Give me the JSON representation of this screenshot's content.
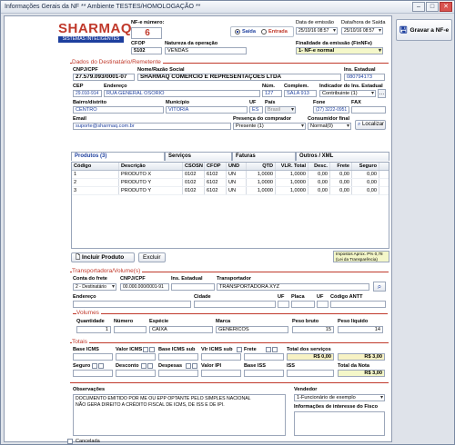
{
  "window": {
    "title": "Informações Gerais da NF  ** Ambiente TESTES/HOMOLOGAÇÃO **"
  },
  "brand": {
    "name": "SHARMAQ",
    "sub": "SISTEMAS INTELIGENTES",
    "color": "#c0392b"
  },
  "header": {
    "nf_number_label": "NF-e número:",
    "nf_number": "6",
    "cfop_label": "CFOP",
    "cfop": "5102",
    "natureza_label": "Natureza da operação",
    "natureza": "VENDAS",
    "saida_label": "Saída",
    "entrada_label": "Entrada",
    "data_emissao_label": "Data de emissão",
    "data_emissao": "25/10/16 08:57",
    "data_saida_label": "Data/hora de Saída",
    "data_saida": "25/10/16 08:57",
    "finalidade_label": "Finalidade da emissão (FinNFe)",
    "finalidade": "1- NF-e normal"
  },
  "dest": {
    "section": "Dados do Destinatário/Remetente",
    "cnpj_label": "CNPJ/CPF",
    "cnpj": "27.579.093/0001-07",
    "nome_label": "Nome/Razão Social",
    "nome": "SHARMAQ COMÉRCIO E REPRESENTAÇÕES LTDA",
    "ie_label": "Ins. Estadual",
    "ie": "080794173",
    "cep_label": "CEP",
    "cep": "29.010-914",
    "endereco_label": "Endereço",
    "endereco": "RUA GENERAL OSÓRIO",
    "num_label": "Núm.",
    "num": "127",
    "compl_label": "Complem.",
    "compl": "SALA 913",
    "ind_ie_label": "Indicador do Ins. Estadual",
    "ind_ie": "Contribuinte (1)",
    "bairro_label": "Bairro/distrito",
    "bairro": "CENTRO",
    "municipio_label": "Município",
    "municipio": "VITÓRIA",
    "uf_label": "UF",
    "uf": "ES",
    "pais_label": "País",
    "pais": "Brasil",
    "fone_label": "Fone",
    "fone": "(27) 3222-0951",
    "fax_label": "FAX",
    "email_label": "Email",
    "email": "suporte@sharmaq.com.br",
    "presenca_label": "Presença do comprador",
    "presenca": "Presente (1)",
    "consumidor_label": "Consumidor final",
    "consumidor": "Normal(0)",
    "localizar": "Localizar"
  },
  "tabs": [
    "Produtos (3)",
    "Serviços",
    "Faturas",
    "Outros / XML"
  ],
  "products": {
    "columns": [
      "Código",
      "Descrição",
      "CSOSN",
      "CFOP",
      "UND",
      "QTD",
      "VLR. Total",
      "Desc.",
      "Frete",
      "Seguro"
    ],
    "rows": [
      [
        "1",
        "PRODUTO X",
        "0102",
        "6102",
        "UN",
        "1,0000",
        "1,0000",
        "0,00",
        "0,00",
        "0,00"
      ],
      [
        "2",
        "PRODUTO Y",
        "0102",
        "6102",
        "UN",
        "1,0000",
        "1,0000",
        "0,00",
        "0,00",
        "0,00"
      ],
      [
        "3",
        "PRODUTO Y",
        "0102",
        "6102",
        "UN",
        "1,0000",
        "1,0000",
        "0,00",
        "0,00",
        "0,00"
      ]
    ],
    "incluir": "Incluir Produto",
    "excluir": "Excluir",
    "imposto_line1": "Impostos Aprox. P% 0,78",
    "imposto_line2": "(Lei da Transparência)"
  },
  "transp": {
    "section": "Transportadora/Volume(s)",
    "conta_label": "Conta do frete",
    "conta": "2 - Destinatário",
    "cnpj_label": "CNPJ/CPF",
    "cnpj": "00.000.000/0001-91",
    "ie_label": "Ins. Estadual",
    "nome_label": "Transportador",
    "nome": "TRANSPORTADORA XYZ",
    "end_label": "Endereço",
    "cidade_label": "Cidade",
    "uf_label": "UF",
    "placa_label": "Placa",
    "uf2_label": "UF",
    "antt_label": "Código ANTT",
    "vol_section": "Volumes",
    "qtd_label": "Quantidade",
    "qtd": "1",
    "numero_label": "Número",
    "especie_label": "Espécie",
    "especie": "CAIXA",
    "marca_label": "Marca",
    "marca": "GENERICOS",
    "pb_label": "Peso bruto",
    "pb": "15",
    "pl_label": "Peso líquido",
    "pl": "14"
  },
  "totais": {
    "section": "Totais",
    "base_icms": "Base ICMS",
    "valor_icms": "Valor ICMS",
    "base_icms_sub": "Base ICMS sub",
    "vlr_icms_sub": "Vlr ICMS sub",
    "frete": "Frete",
    "total_servicos": "Total dos serviços",
    "total_servicos_val": "R$ 0,00",
    "total_prod_val": "R$ 3,00",
    "seguro": "Seguro",
    "desconto": "Desconto",
    "despesas": "Despesas",
    "valor_ipi": "Valor IPI",
    "base_iss": "Base ISS",
    "iss": "ISS",
    "total_nota": "Total da Nota",
    "total_nota_val": "R$ 3,00"
  },
  "obs": {
    "label": "Observações",
    "text1": "DOCUMENTO EMITIDO POR ME OU EPP OPTANTE PELO SIMPLES NACIONAL",
    "text2": "NÃO GERA DIREITO A CRÉDITO FISCAL DE ICMS, DE ISS E DE IPI.",
    "vendedor_label": "Vendedor",
    "vendedor": "1-Funcionário de exemplo",
    "fisco_label": "Informações de interesse do Fisco",
    "cancelada": "Cancelada"
  },
  "side": {
    "gravar": "Gravar a NF-e"
  }
}
